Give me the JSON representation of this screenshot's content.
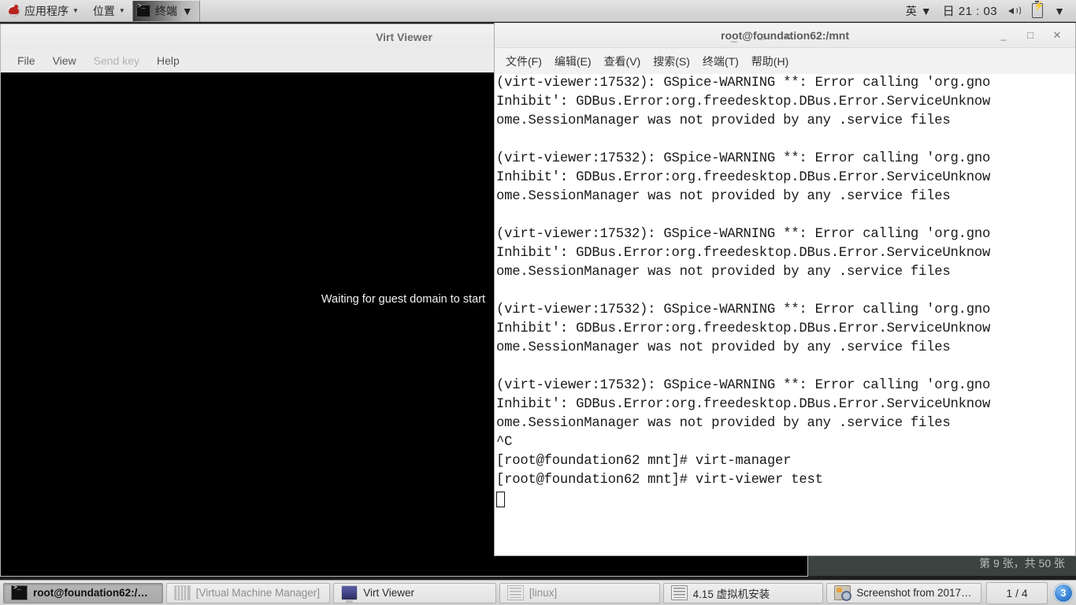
{
  "top_panel": {
    "logo_name": "redhat-logo",
    "menus": [
      {
        "label": "应用程序",
        "name": "applications-menu"
      },
      {
        "label": "位置",
        "name": "places-menu"
      }
    ],
    "active_app": {
      "label": "终端",
      "name": "terminal-panel-button"
    },
    "right": {
      "input_method": "英",
      "clock": "日 21 : 03",
      "speaker_icon": "speaker-icon",
      "battery_icon": "battery-icon",
      "caret": "▼"
    }
  },
  "virt_viewer": {
    "title": "Virt Viewer",
    "menus": [
      {
        "label": "File",
        "name": "menu-file",
        "disabled": false
      },
      {
        "label": "View",
        "name": "menu-view",
        "disabled": false
      },
      {
        "label": "Send key",
        "name": "menu-send-key",
        "disabled": true
      },
      {
        "label": "Help",
        "name": "menu-help",
        "disabled": false
      }
    ],
    "canvas_message": "Waiting for guest domain to start",
    "window_buttons": {
      "minimize": "_",
      "maximize": "□",
      "close": "✕"
    }
  },
  "background_window": {
    "status_text": "第 9 张，共 50 张",
    "window_buttons": {
      "minimize": "_",
      "maximize": "□",
      "close": "✕"
    }
  },
  "terminal": {
    "title": "root@foundation62:/mnt",
    "menus": [
      {
        "label": "文件(F)",
        "name": "menu-file"
      },
      {
        "label": "编辑(E)",
        "name": "menu-edit"
      },
      {
        "label": "查看(V)",
        "name": "menu-view"
      },
      {
        "label": "搜索(S)",
        "name": "menu-search"
      },
      {
        "label": "终端(T)",
        "name": "menu-terminal"
      },
      {
        "label": "帮助(H)",
        "name": "menu-help"
      }
    ],
    "window_buttons": {
      "minimize": "_",
      "maximize": "□",
      "close": "✕"
    },
    "output": "(virt-viewer:17532): GSpice-WARNING **: Error calling 'org.gno\nInhibit': GDBus.Error:org.freedesktop.DBus.Error.ServiceUnknow\nome.SessionManager was not provided by any .service files\n\n(virt-viewer:17532): GSpice-WARNING **: Error calling 'org.gno\nInhibit': GDBus.Error:org.freedesktop.DBus.Error.ServiceUnknow\nome.SessionManager was not provided by any .service files\n\n(virt-viewer:17532): GSpice-WARNING **: Error calling 'org.gno\nInhibit': GDBus.Error:org.freedesktop.DBus.Error.ServiceUnknow\nome.SessionManager was not provided by any .service files\n\n(virt-viewer:17532): GSpice-WARNING **: Error calling 'org.gno\nInhibit': GDBus.Error:org.freedesktop.DBus.Error.ServiceUnknow\nome.SessionManager was not provided by any .service files\n\n(virt-viewer:17532): GSpice-WARNING **: Error calling 'org.gno\nInhibit': GDBus.Error:org.freedesktop.DBus.Error.ServiceUnknow\nome.SessionManager was not provided by any .service files\n^C\n[root@foundation62 mnt]# virt-manager\n[root@foundation62 mnt]# virt-viewer test"
  },
  "taskbar": {
    "items": [
      {
        "label": "root@foundation62:/mnt",
        "icon": "terminal-icon",
        "state": "active",
        "name": "taskbar-item-terminal"
      },
      {
        "label": "[Virtual Machine Manager]",
        "icon": "vmm-icon",
        "state": "minimized",
        "name": "taskbar-item-virt-machine-manager"
      },
      {
        "label": "Virt Viewer",
        "icon": "virt-viewer-icon",
        "state": "normal",
        "name": "taskbar-item-virt-viewer"
      },
      {
        "label": "[linux]",
        "icon": "document-icon",
        "state": "minimized",
        "name": "taskbar-item-linux"
      },
      {
        "label": "4.15 虚拟机安装",
        "icon": "document-icon",
        "state": "normal",
        "name": "taskbar-item-vm-install-doc"
      },
      {
        "label": "Screenshot from 2017-⋯",
        "icon": "screenshot-icon",
        "state": "normal",
        "name": "taskbar-item-screenshot"
      }
    ],
    "workspace": "1 / 4",
    "notification_count": "3"
  },
  "colors": {
    "panel_bg": "#d8d8d8",
    "taskbar_bg": "#dcdcdc",
    "terminal_bg": "#ffffff",
    "terminal_fg": "#1a1a1a",
    "canvas_bg": "#000000",
    "dark_titlebar": "#3b423f",
    "accent_badge": "#3a86d6"
  }
}
